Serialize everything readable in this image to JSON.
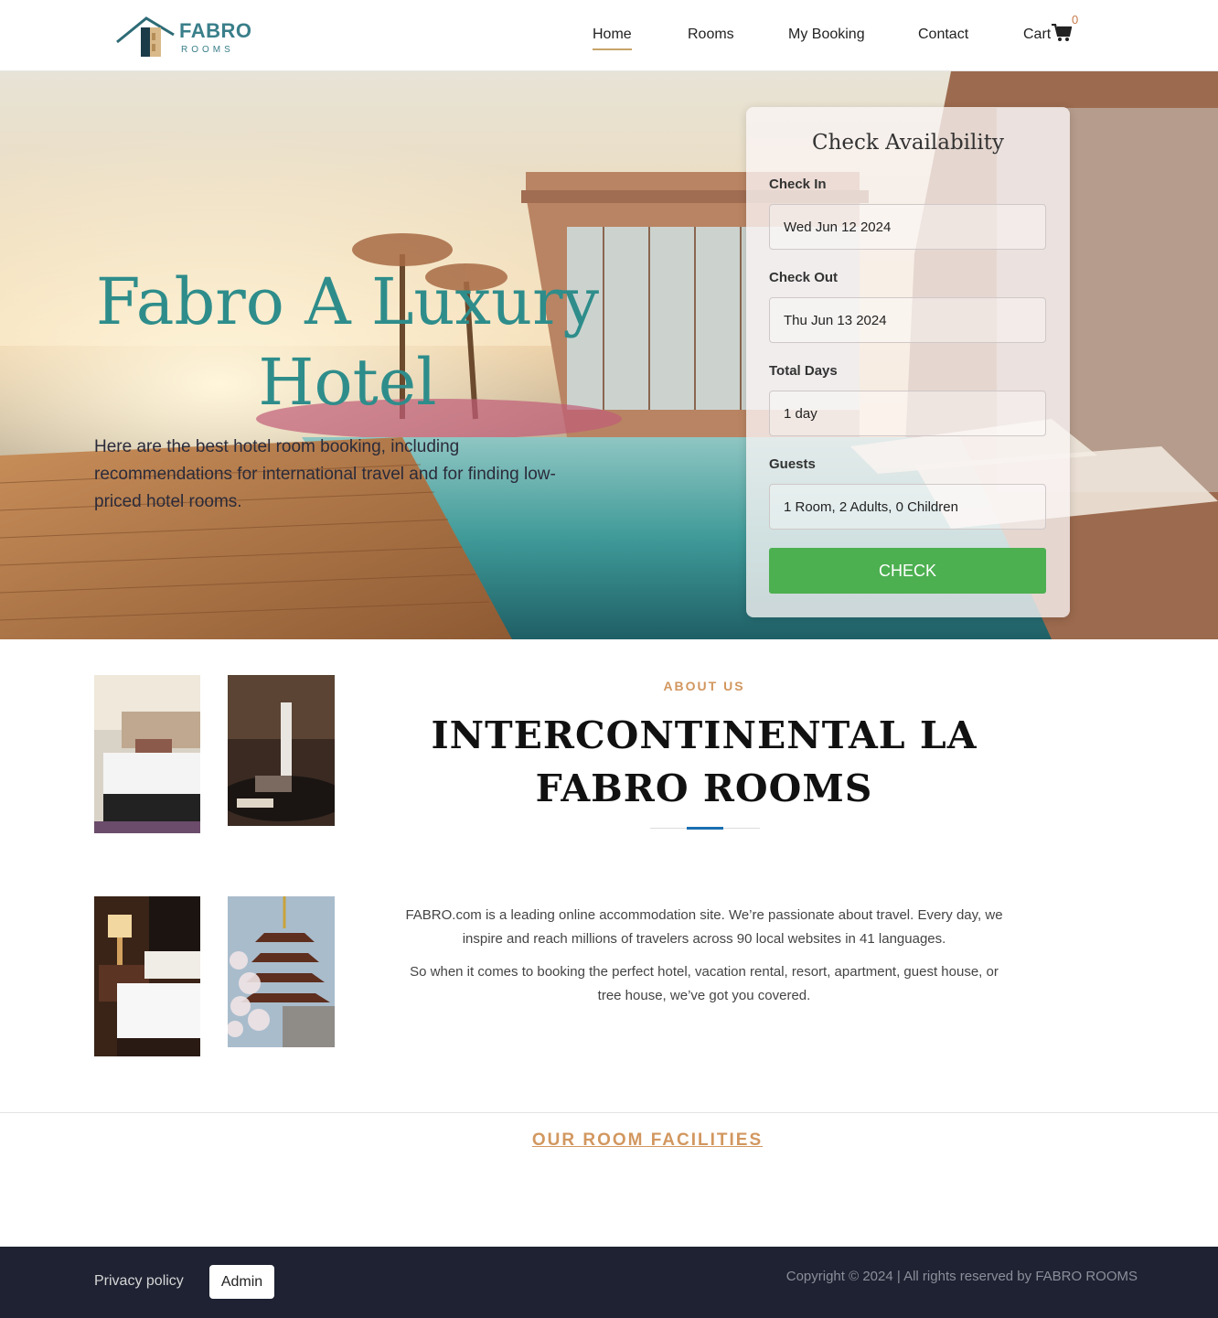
{
  "brand": {
    "name": "FABRO",
    "sub": "ROOMS"
  },
  "nav": {
    "items": [
      {
        "label": "Home",
        "active": true
      },
      {
        "label": "Rooms"
      },
      {
        "label": "My Booking"
      },
      {
        "label": "Contact"
      },
      {
        "label": "Cart"
      }
    ],
    "cart_count": "0",
    "cart_icon": "shopping-cart-icon"
  },
  "hero": {
    "title": "Fabro A Luxury Hotel",
    "description": "Here are the best hotel room booking, including recommendations for international travel and for finding low-priced hotel rooms."
  },
  "availability": {
    "title": "Check Availability",
    "check_in_label": "Check In",
    "check_in_value": "Wed Jun 12 2024",
    "check_out_label": "Check Out",
    "check_out_value": "Thu Jun 13 2024",
    "total_days_label": "Total Days",
    "total_days_value": "1 day",
    "guests_label": "Guests",
    "guests_value": "1 Room, 2 Adults, 0 Children",
    "button": "CHECK"
  },
  "about": {
    "kicker": "ABOUT US",
    "title": "INTERCONTINENTAL LA FABRO ROOMS",
    "p1": "FABRO.com is a leading online accommodation site. We’re passionate about travel. Every day, we inspire and reach millions of travelers across 90 local websites in 41 languages.",
    "p2": "So when it comes to booking the perfect hotel, vacation rental, resort, apartment, guest house, or tree house, we’ve got you covered."
  },
  "facilities": {
    "heading": "OUR ROOM FACILITIES"
  },
  "footer": {
    "privacy": "Privacy policy",
    "admin": "Admin",
    "copyright": "Copyright © 2024 | All rights reserved by FABRO ROOMS"
  },
  "colors": {
    "accent_teal": "#2e8d8b",
    "accent_gold": "#d2975f",
    "check_green": "#4caf50",
    "footer_bg": "#1e2232",
    "divider_blue": "#1a6fb0"
  }
}
